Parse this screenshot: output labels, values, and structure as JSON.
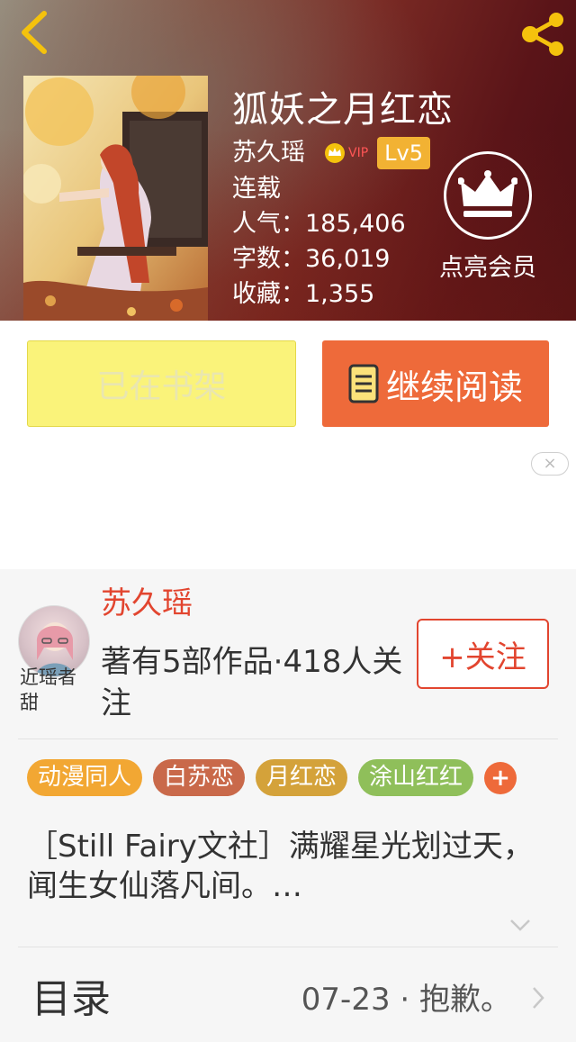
{
  "header": {
    "back_icon": "chevron-left-icon",
    "share_icon": "share-icon"
  },
  "book": {
    "title": "狐妖之月红恋",
    "author": "苏久瑶",
    "vip_label": "VIP",
    "level": "Lv5",
    "status": "连载",
    "popularity_label": "人气：",
    "popularity": "185,406",
    "word_count_label": "字数：",
    "word_count": "36,019",
    "favorites_label": "收藏：",
    "favorites": "1,355"
  },
  "member": {
    "icon": "crown-icon",
    "label": "点亮会员"
  },
  "actions": {
    "shelf_label": "已在书架",
    "read_label": "继续阅读"
  },
  "ad": {
    "close_label": "×"
  },
  "author_section": {
    "name": "苏久瑶",
    "description": "著有5部作品·418人关注",
    "follow_label": "+关注",
    "avatar_caption": "近瑶者甜"
  },
  "tags": [
    {
      "label": "动漫同人",
      "color": "#f2a733"
    },
    {
      "label": "白苏恋",
      "color": "#c9694a"
    },
    {
      "label": "月红恋",
      "color": "#d4a23a"
    },
    {
      "label": "涂山红红",
      "color": "#8fbf5a"
    }
  ],
  "tag_add_label": "+",
  "intro": "［Still Fairy文社］满耀星光划过天，闻生女仙落凡间。…",
  "toc": {
    "label": "目录",
    "latest": "07-23 · 抱歉。"
  }
}
